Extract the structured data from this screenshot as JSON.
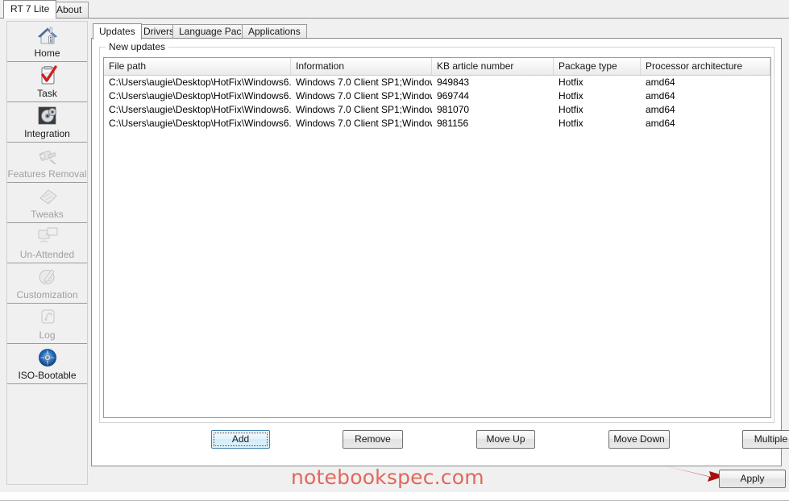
{
  "window": {
    "outer_tabs": [
      {
        "label": "RT 7 Lite",
        "active": true
      },
      {
        "label": "About",
        "active": false
      }
    ]
  },
  "sidebar": {
    "items": [
      {
        "label": "Home",
        "icon": "house-icon",
        "enabled": true
      },
      {
        "label": "Task",
        "icon": "clipboard-check-icon",
        "enabled": true
      },
      {
        "label": "Integration",
        "icon": "disc-gear-icon",
        "enabled": true
      },
      {
        "label": "Features Removal",
        "icon": "wrench-parts-icon",
        "enabled": false
      },
      {
        "label": "Tweaks",
        "icon": "sliders-icon",
        "enabled": false
      },
      {
        "label": "Un-Attended",
        "icon": "two-monitors-icon",
        "enabled": false
      },
      {
        "label": "Customization",
        "icon": "paint-palette-icon",
        "enabled": false
      },
      {
        "label": "Log",
        "icon": "notepad-icon",
        "enabled": false
      },
      {
        "label": "ISO-Bootable",
        "icon": "cd-disc-icon",
        "enabled": true
      }
    ]
  },
  "main": {
    "tabs": [
      {
        "label": "Updates",
        "active": true
      },
      {
        "label": "Drivers",
        "active": false
      },
      {
        "label": "Language Packs",
        "active": false
      },
      {
        "label": "Applications",
        "active": false
      }
    ],
    "groupbox_title": "New updates",
    "table": {
      "columns": [
        "File path",
        "Information",
        "KB article number",
        "Package type",
        "Processor architecture"
      ],
      "rows": [
        [
          "C:\\Users\\augie\\Desktop\\HotFix\\Windows6...",
          "Windows 7.0 Client SP1;Window...",
          "949843",
          "Hotfix",
          "amd64"
        ],
        [
          "C:\\Users\\augie\\Desktop\\HotFix\\Windows6...",
          "Windows 7.0 Client SP1;Window...",
          "969744",
          "Hotfix",
          "amd64"
        ],
        [
          "C:\\Users\\augie\\Desktop\\HotFix\\Windows6...",
          "Windows 7.0 Client SP1;Window...",
          "981070",
          "Hotfix",
          "amd64"
        ],
        [
          "C:\\Users\\augie\\Desktop\\HotFix\\Windows6...",
          "Windows 7.0 Client SP1;Window...",
          "981156",
          "Hotfix",
          "amd64"
        ]
      ]
    },
    "buttons": {
      "add": "Add",
      "remove": "Remove",
      "move_up": "Move Up",
      "move_down": "Move Down",
      "multiple_updates": "Multiple Updates"
    }
  },
  "footer": {
    "watermark": "notebookspec.com",
    "apply_label": "Apply",
    "arrow_icon": "red-arrow-right-icon"
  },
  "colors": {
    "watermark": "#e0685c",
    "arrow": "#a80f0f",
    "focus_border": "#3c7fb1",
    "window_background": "#f0f0f0",
    "panel_background": "#ffffff"
  }
}
